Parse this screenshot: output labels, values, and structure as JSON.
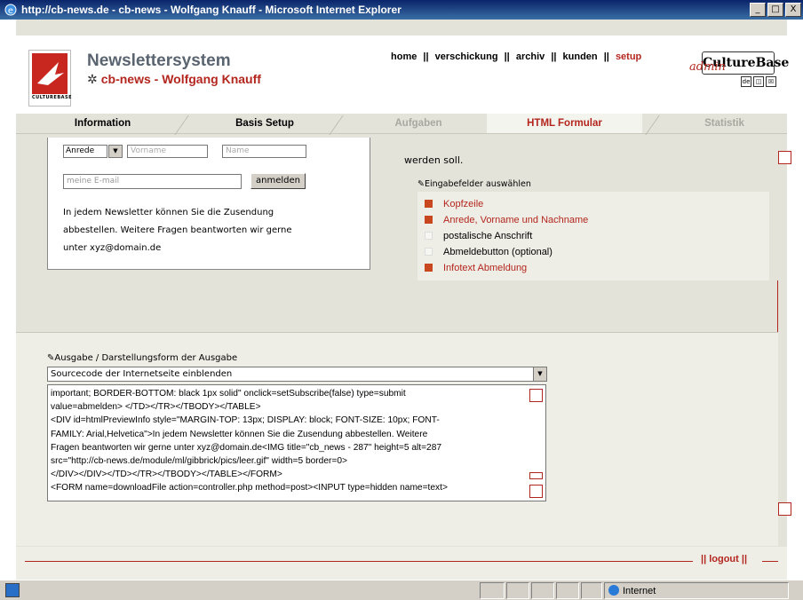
{
  "window": {
    "title": "http://cb-news.de - cb-news - Wolfgang Knauff - Microsoft Internet Explorer",
    "minimize": "_",
    "maximize": "□",
    "close": "X"
  },
  "header": {
    "app_title": "Newslettersystem",
    "app_subtitle": "cb-news - Wolfgang Knauff",
    "star": "✲",
    "logo_text": "CULTUREBASE",
    "brand": "CultureBase",
    "brand_admin": "admin",
    "mini_buttons": [
      "de",
      "◫",
      "☒"
    ]
  },
  "topnav": {
    "items": [
      "home",
      "verschickung",
      "archiv",
      "kunden",
      "setup"
    ],
    "separator": "||",
    "active": "setup"
  },
  "tabs": [
    {
      "label": "Information",
      "state": "normal"
    },
    {
      "label": "Basis Setup",
      "state": "normal"
    },
    {
      "label": "Aufgaben",
      "state": "dim"
    },
    {
      "label": "HTML Formular",
      "state": "active"
    },
    {
      "label": "Statistik",
      "state": "dim"
    }
  ],
  "preview": {
    "anrede": "Anrede",
    "vorname_placeholder": "Vorname",
    "name_placeholder": "Name",
    "email_placeholder": "meine E-mail",
    "button": "anmelden",
    "info_lines": [
      "In jedem Newsletter können Sie die Zusendung",
      "abbestellen. Weitere Fragen beantworten wir gerne",
      "unter xyz@domain.de"
    ]
  },
  "right_panel": {
    "top_text": "werden soll.",
    "heading": "Eingabefelder auswählen",
    "options": [
      {
        "label": "Kopfzeile",
        "checked": true
      },
      {
        "label": "Anrede, Vorname und Nachname",
        "checked": true
      },
      {
        "label": "postalische Anschrift",
        "checked": false
      },
      {
        "label": "Abmeldebutton (optional)",
        "checked": false
      },
      {
        "label": "Infotext Abmeldung",
        "checked": true
      }
    ]
  },
  "output": {
    "heading": "Ausgabe / Darstellungsform der Ausgabe",
    "select_value": "Sourcecode der Internetseite einblenden",
    "source_lines": [
      "important; BORDER-BOTTOM: black 1px solid\" onclick=setSubscribe(false) type=submit",
      "value=abmelden> </TD></TR></TBODY></TABLE>",
      "<DIV id=htmlPreviewInfo style=\"MARGIN-TOP: 13px; DISPLAY: block; FONT-SIZE: 10px; FONT-",
      "FAMILY: Arial,Helvetica\">In jedem Newsletter können Sie die Zusendung abbestellen. Weitere",
      "Fragen beantworten wir gerne unter xyz@domain.de<IMG title=\"cb_news - 287\" height=5 alt=287",
      "src=\"http://cb-news.de/module/ml/gibbrick/pics/leer.gif\" width=5 border=0>",
      "</DIV></DIV></TD></TR></TBODY></TABLE></FORM>",
      "<FORM name=downloadFile action=controller.php method=post><INPUT type=hidden name=text>"
    ]
  },
  "footer": {
    "logout": "|| logout ||"
  },
  "statusbar": {
    "zone": "Internet"
  },
  "colors": {
    "accent": "#b3261e",
    "panel": "#e3e3da",
    "titlebar": "#0a246a"
  }
}
